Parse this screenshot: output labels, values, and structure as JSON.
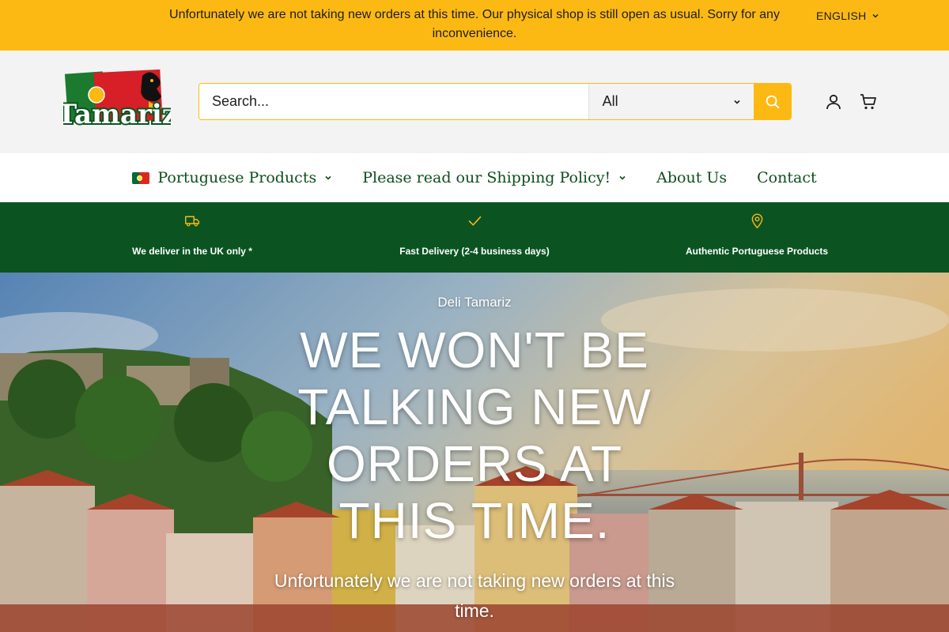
{
  "announcement": {
    "text": "Unfortunately we are not taking new orders at this time. Our physical shop is still open as usual. Sorry for any inconvenience.",
    "language": "ENGLISH"
  },
  "header": {
    "logo_text": "Tamariz",
    "search_placeholder": "Search...",
    "category_select": "All"
  },
  "nav": {
    "items": [
      {
        "label": "Portuguese Products",
        "has_dropdown": true,
        "icon": "portugal-flag"
      },
      {
        "label": "Please read our Shipping Policy!",
        "has_dropdown": true
      },
      {
        "label": "About Us",
        "has_dropdown": false
      },
      {
        "label": "Contact",
        "has_dropdown": false
      }
    ]
  },
  "features": [
    {
      "icon": "truck-icon",
      "label": "We deliver in the UK only *"
    },
    {
      "icon": "check-icon",
      "label": "Fast Delivery (2-4 business days)"
    },
    {
      "icon": "map-pin-icon",
      "label": "Authentic Portuguese Products"
    }
  ],
  "hero": {
    "subheading": "Deli Tamariz",
    "title": "WE WON'T BE TALKING NEW ORDERS AT THIS TIME.",
    "text": "Unfortunately we are not taking new orders at this time."
  },
  "colors": {
    "accent_yellow": "#fdb913",
    "brand_green": "#0b5422",
    "nav_green": "#0e4e1c",
    "header_bg": "#f3f3f3"
  }
}
